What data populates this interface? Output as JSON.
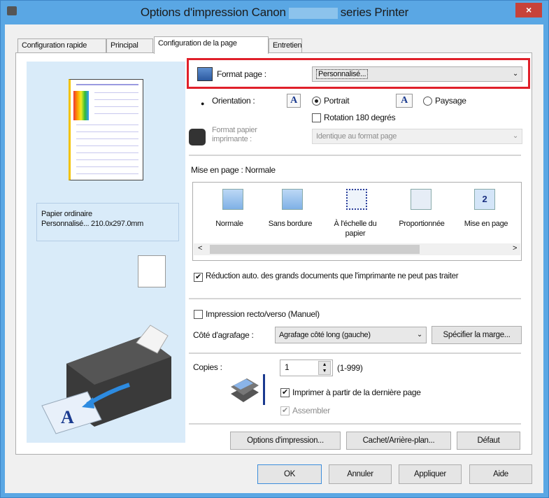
{
  "window": {
    "title_prefix": "Options d'impression Canon",
    "title_suffix": "series Printer",
    "close": "×"
  },
  "tabs": [
    {
      "label": "Configuration rapide"
    },
    {
      "label": "Principal"
    },
    {
      "label": "Configuration de la page"
    },
    {
      "label": "Entretien"
    }
  ],
  "preview": {
    "paper_type": "Papier ordinaire",
    "paper_size": "Personnalisé... 210.0x297.0mm"
  },
  "format_page": {
    "label": "Format page :",
    "value": "Personnalisé...",
    "highlight_color": "#e0202a"
  },
  "orientation": {
    "label": "Orientation :",
    "portrait": "Portrait",
    "paysage": "Paysage",
    "selected": "Portrait",
    "icon_glyph": "A"
  },
  "rotation": {
    "label": "Rotation 180 degrés",
    "checked": false
  },
  "printer_paper": {
    "label_line1": "Format papier",
    "label_line2": "imprimante :",
    "value": "Identique au format page"
  },
  "layout": {
    "label": "Mise en page : Normale",
    "items": [
      {
        "label": "Normale"
      },
      {
        "label": "Sans bordure"
      },
      {
        "label": "À l'échelle du papier"
      },
      {
        "label": "Proportionnée"
      },
      {
        "label": "Mise en page",
        "badge": "2"
      }
    ],
    "scroll_left": "<",
    "scroll_right": ">"
  },
  "reduction": {
    "label": "Réduction auto. des grands documents que l'imprimante ne peut pas traiter",
    "checked": true
  },
  "duplex": {
    "label": "Impression recto/verso (Manuel)",
    "checked": false
  },
  "stapling": {
    "label": "Côté d'agrafage :",
    "value": "Agrafage côté long (gauche)",
    "margin_button": "Spécifier la marge..."
  },
  "copies": {
    "label": "Copies :",
    "value": "1",
    "range": "(1-999)",
    "reverse_label": "Imprimer à partir de la dernière page",
    "reverse_checked": true,
    "collate_label": "Assembler",
    "collate_checked": true
  },
  "actions": {
    "print_options": "Options d'impression...",
    "stamp": "Cachet/Arrière-plan...",
    "default": "Défaut"
  },
  "footer": {
    "ok": "OK",
    "cancel": "Annuler",
    "apply": "Appliquer",
    "help": "Aide"
  },
  "check_mark": "✔",
  "arrow_down": "⌄"
}
